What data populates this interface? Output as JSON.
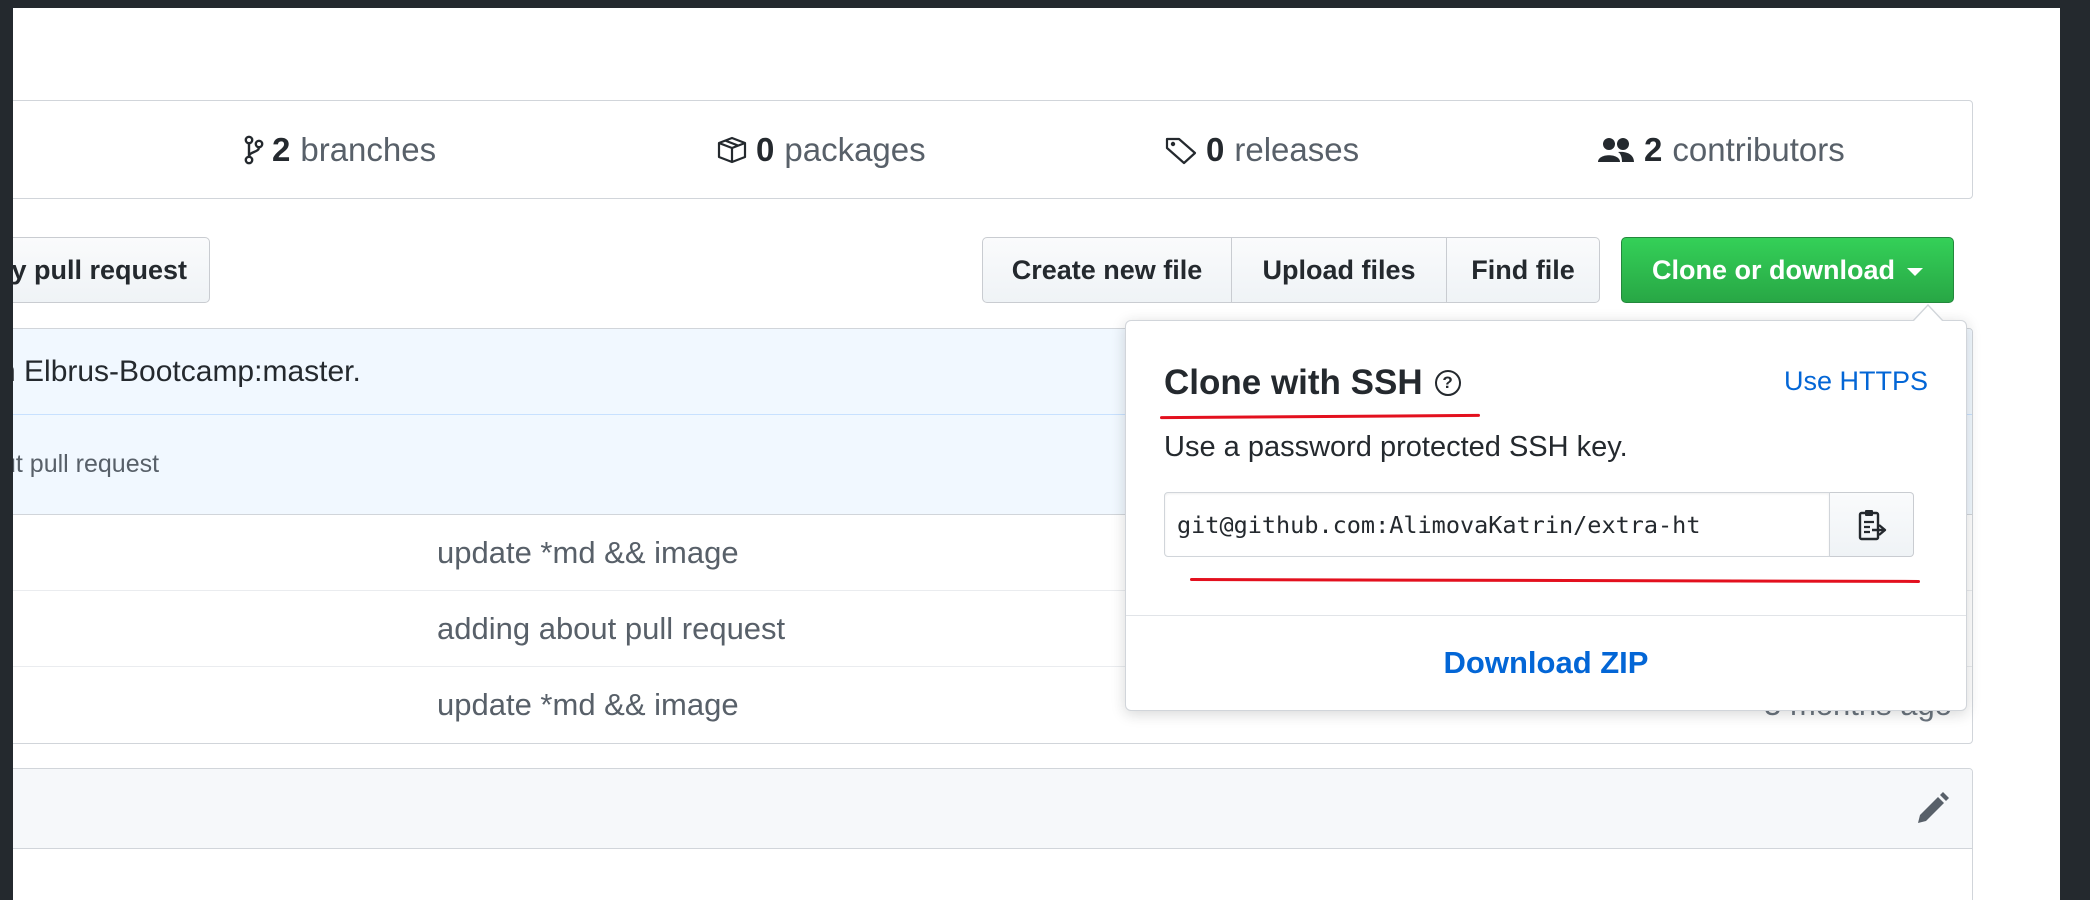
{
  "summary": {
    "branches": {
      "count": "2",
      "label": "branches"
    },
    "packages": {
      "count": "0",
      "label": "packages"
    },
    "releases": {
      "count": "0",
      "label": "releases"
    },
    "contributors": {
      "count": "2",
      "label": "contributors"
    }
  },
  "toolbar": {
    "pull_request_label": "y pull request",
    "create_new_file_label": "Create new file",
    "upload_files_label": "Upload files",
    "find_file_label": "Find file",
    "clone_label": "Clone or download"
  },
  "commit_tease": {
    "text": "n Elbrus-Bootcamp:master.",
    "sub_text": "ut pull request"
  },
  "files": [
    {
      "message": "update *md && image",
      "age": ""
    },
    {
      "message": "adding about pull request",
      "age": ""
    },
    {
      "message": "update *md && image",
      "age": "5 months ago"
    }
  ],
  "clone_dropdown": {
    "title": "Clone with SSH",
    "help_glyph": "?",
    "use_https_label": "Use HTTPS",
    "description": "Use a password protected SSH key.",
    "url": "git@github.com:AlimovaKatrin/extra-ht",
    "download_zip_label": "Download ZIP"
  },
  "colors": {
    "clone_button": "#2ea44f",
    "link": "#0366d6",
    "annotation_underline": "#e3101e",
    "frame": "#24292e"
  },
  "icons": [
    "git-branch-icon",
    "package-icon",
    "tag-icon",
    "people-icon",
    "clipboard-icon",
    "pencil-icon"
  ]
}
